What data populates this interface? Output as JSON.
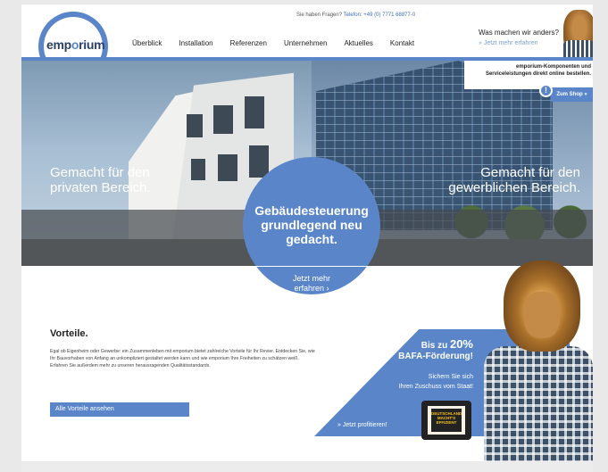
{
  "header": {
    "question": "Sie haben Fragen?",
    "phone": "Telefon: +49 (0) 7771 68877-0",
    "logo_prefix": "emp",
    "logo_o": "o",
    "logo_suffix": "rium",
    "nav": [
      "Überblick",
      "Installation",
      "Referenzen",
      "Unternehmen",
      "Aktuelles",
      "Kontakt"
    ],
    "diff_title": "Was machen wir anders?",
    "diff_link": "» Jetzt mehr erfahren",
    "shop_line1": "emporium-Komponenten und",
    "shop_line2": "Serviceleistungen direkt online bestellen.",
    "shop_button": "Zum Shop »",
    "alert_glyph": "!"
  },
  "hero": {
    "left_line1": "Gemacht für den",
    "left_line2": "privaten Bereich.",
    "right_line1": "Gemacht für den",
    "right_line2": "gewerblichen Bereich.",
    "circle_line1": "Gebäudesteuerung",
    "circle_line2": "grundlegend neu",
    "circle_line3": "gedacht.",
    "circle_link1": "Jetzt mehr",
    "circle_link2": "erfahren ›"
  },
  "vorteile": {
    "title": "Vorteile.",
    "text": "Egal ob Eigenheim oder Gewerbe: ein Zusammenleben mit emporium bietet zahlreiche Vorteile für Ihr Revier. Entdecken Sie, wie Ihr Bauvorhaben von Anfang an unkompliziert gestaltet werden kann und wie emporium Ihre Freiheiten zu schätzen weiß. Erfahren Sie außerdem mehr zu unseren herausragenden Qualitätsstandards.",
    "button": "Alle Vorteile ansehen"
  },
  "bafa": {
    "line1_prefix": "Bis zu ",
    "line1_value": "20%",
    "line2": "BAFA-Förderung!",
    "sub1": "Sichern Sie sich",
    "sub2": "Ihren Zuschuss vom Staat!",
    "link": "» Jetzt profitieren!",
    "badge": "DEUTSCHLAND MACHT'S EFFIZIENT"
  },
  "colors": {
    "accent": "#5a86c9",
    "dark": "#2a3f66"
  }
}
